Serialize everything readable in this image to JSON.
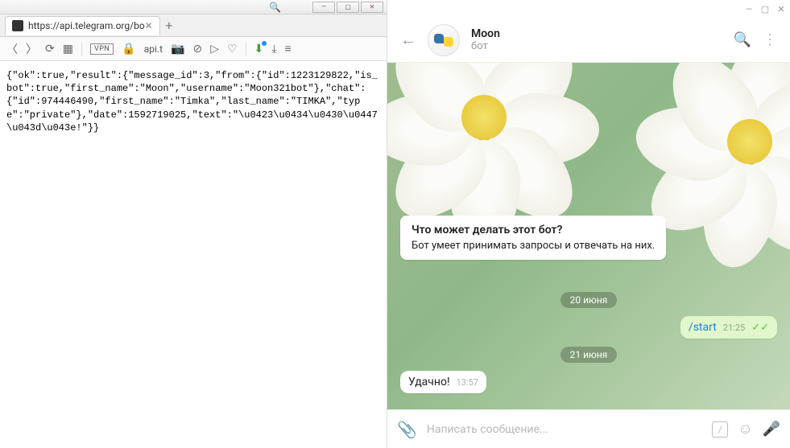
{
  "browser": {
    "tab_title": "https://api.telegram.org/bo",
    "address_display": "api.t",
    "toolbar": {
      "vpn_label": "VPN"
    },
    "body": "{\"ok\":true,\"result\":{\"message_id\":3,\"from\":{\"id\":1223129822,\"is_bot\":true,\"first_name\":\"Moon\",\"username\":\"Moon321bot\"},\"chat\":{\"id\":974446490,\"first_name\":\"Timka\",\"last_name\":\"TIMKA\",\"type\":\"private\"},\"date\":1592719025,\"text\":\"\\u0423\\u0434\\u0430\\u0447\\u043d\\u043e!\"}}"
  },
  "telegram": {
    "chat_name": "Moon",
    "chat_sub": "бот",
    "bot_info_title": "Что может делать этот бот?",
    "bot_info_desc": "Бот умеет принимать запросы и отвечать на них.",
    "date1": "20 июня",
    "msg_out_text": "/start",
    "msg_out_time": "21:25",
    "date2": "21 июня",
    "msg_in_text": "Удачно!",
    "msg_in_time": "13:57",
    "input_placeholder": "Написать сообщение..."
  }
}
